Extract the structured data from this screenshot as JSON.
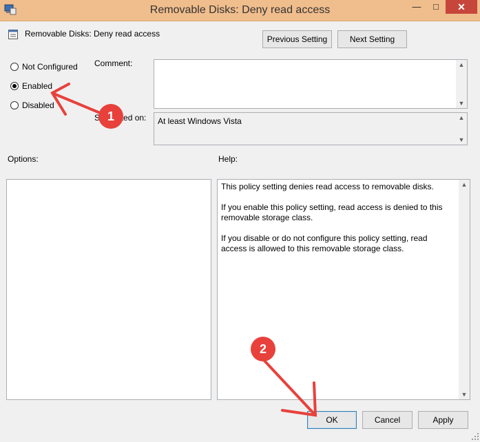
{
  "window": {
    "title": "Removable Disks: Deny read access"
  },
  "header": {
    "policy_name": "Removable Disks: Deny read access"
  },
  "nav": {
    "previous_label": "Previous Setting",
    "next_label": "Next Setting"
  },
  "state": {
    "options": [
      {
        "label": "Not Configured",
        "checked": false
      },
      {
        "label": "Enabled",
        "checked": true
      },
      {
        "label": "Disabled",
        "checked": false
      }
    ]
  },
  "comment": {
    "label": "Comment:",
    "value": ""
  },
  "supported": {
    "label": "Supported on:",
    "value": "At least Windows Vista"
  },
  "options_section": {
    "label": "Options:"
  },
  "help": {
    "label": "Help:",
    "paragraphs": [
      "This policy setting denies read access to removable disks.",
      "If you enable this policy setting, read access is denied to this removable storage class.",
      "If you disable or do not configure this policy setting, read access is allowed to this removable storage class."
    ]
  },
  "footer": {
    "ok_label": "OK",
    "cancel_label": "Cancel",
    "apply_label": "Apply"
  },
  "annotations": [
    {
      "number": "1"
    },
    {
      "number": "2"
    }
  ],
  "colors": {
    "title_bar": "#f0bd8c",
    "close_button": "#c7463b",
    "annotation": "#e8413b"
  }
}
